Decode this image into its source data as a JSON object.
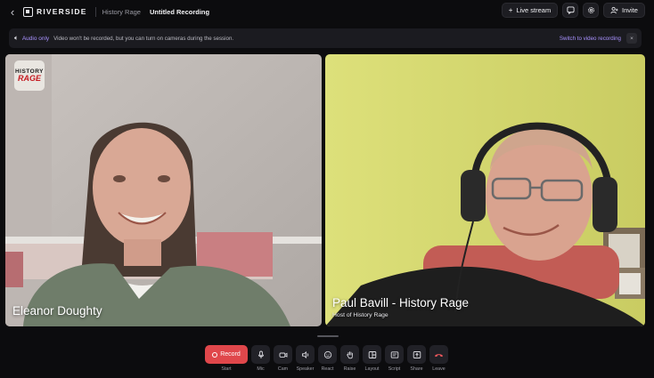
{
  "header": {
    "brand": "RIVERSIDE",
    "studio_name": "History Rage",
    "recording_title": "Untitled Recording",
    "live_stream_label": "Live stream",
    "invite_label": "Invite"
  },
  "banner": {
    "mode_label": "Audio only",
    "message": "Video won't be recorded, but you can turn on cameras during the session.",
    "switch_label": "Switch to video recording",
    "close_glyph": "×"
  },
  "participants": [
    {
      "name": "Eleanor Doughty",
      "subtitle": ""
    },
    {
      "name": "Paul Bavill - History Rage",
      "subtitle": "Host of History Rage"
    }
  ],
  "logo": {
    "line1": "HISTORY",
    "line2": "RAGE"
  },
  "toolbar": {
    "record": {
      "button": "Record",
      "label": "Start"
    },
    "items": [
      {
        "icon": "mic-icon",
        "label": "Mic"
      },
      {
        "icon": "camera-icon",
        "label": "Cam"
      },
      {
        "icon": "speaker-icon",
        "label": "Speaker"
      },
      {
        "icon": "react-icon",
        "label": "React"
      },
      {
        "icon": "hand-icon",
        "label": "Raise"
      },
      {
        "icon": "layout-icon",
        "label": "Layout"
      },
      {
        "icon": "script-icon",
        "label": "Script"
      },
      {
        "icon": "share-screen-icon",
        "label": "Share"
      },
      {
        "icon": "leave-phone-icon",
        "label": "Leave"
      }
    ]
  },
  "colors": {
    "accent": "#a992ff",
    "record": "#e0474b",
    "background": "#0c0c0e"
  }
}
